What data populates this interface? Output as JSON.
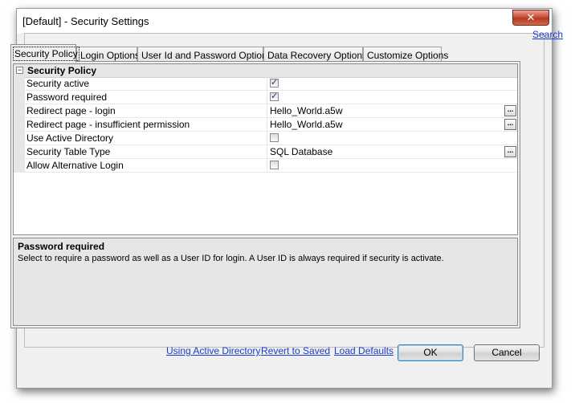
{
  "window": {
    "title": "[Default] - Security Settings",
    "close_glyph": "✕"
  },
  "search_link": "Search",
  "tabs": [
    {
      "label": "Security Policy",
      "active": true
    },
    {
      "label": "Login Options"
    },
    {
      "label": "User Id and Password Options"
    },
    {
      "label": "Data Recovery Options"
    },
    {
      "label": "Customize Options"
    }
  ],
  "grid": {
    "collapse_glyph": "−",
    "section": "Security Policy",
    "rows": [
      {
        "name": "Security active",
        "type": "checkbox",
        "checked": true
      },
      {
        "name": "Password required",
        "type": "checkbox",
        "checked": true
      },
      {
        "name": "Redirect page - login",
        "type": "text",
        "value": "Hello_World.a5w",
        "ellipsis": true
      },
      {
        "name": "Redirect page - insufficient permission",
        "type": "text",
        "value": "Hello_World.a5w",
        "ellipsis": true
      },
      {
        "name": "Use Active Directory",
        "type": "checkbox",
        "checked": false
      },
      {
        "name": "Security Table Type",
        "type": "text",
        "value": "SQL Database",
        "ellipsis": true
      },
      {
        "name": "Allow Alternative Login",
        "type": "checkbox",
        "checked": false
      }
    ],
    "ellipsis_glyph": "..."
  },
  "description": {
    "title": "Password required",
    "text": "Select to require a password as well as a User ID for login.  A User ID is always required if security is activate."
  },
  "footer": {
    "link_active_directory": "Using Active Directory",
    "link_revert": "Revert to Saved",
    "link_load_defaults": "Load Defaults",
    "ok_label": "OK",
    "cancel_label": "Cancel"
  }
}
